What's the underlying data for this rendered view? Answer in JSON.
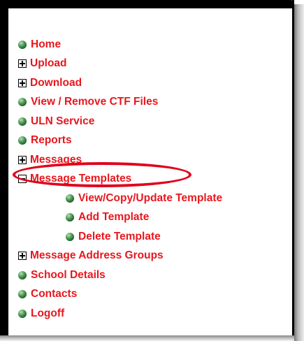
{
  "menu": {
    "items": [
      {
        "label": "Home",
        "icon": "bullet-icon",
        "level": 0
      },
      {
        "label": "Upload",
        "icon": "expand-plus-icon",
        "level": 0
      },
      {
        "label": "Download",
        "icon": "expand-plus-icon",
        "level": 0
      },
      {
        "label": "View / Remove CTF Files",
        "icon": "bullet-icon",
        "level": 0
      },
      {
        "label": "ULN Service",
        "icon": "bullet-icon",
        "level": 0
      },
      {
        "label": "Reports",
        "icon": "bullet-icon",
        "level": 0
      },
      {
        "label": "Messages",
        "icon": "expand-plus-icon",
        "level": 0
      },
      {
        "label": "Message Templates",
        "icon": "collapse-minus-icon",
        "level": 0,
        "expanded": true,
        "highlighted": true
      },
      {
        "label": "View/Copy/Update Template",
        "icon": "bullet-icon",
        "level": 1
      },
      {
        "label": "Add Template",
        "icon": "bullet-icon",
        "level": 1
      },
      {
        "label": "Delete Template",
        "icon": "bullet-icon",
        "level": 1
      },
      {
        "label": "Message Address Groups",
        "icon": "expand-plus-icon",
        "level": 0
      },
      {
        "label": "School Details",
        "icon": "bullet-icon",
        "level": 0
      },
      {
        "label": "Contacts",
        "icon": "bullet-icon",
        "level": 0
      },
      {
        "label": "Logoff",
        "icon": "bullet-icon",
        "level": 0
      }
    ]
  },
  "colors": {
    "link": "#e8171e",
    "bullet": "#2e7a3a",
    "highlight_ring": "#e0001b",
    "border": "#000000"
  }
}
